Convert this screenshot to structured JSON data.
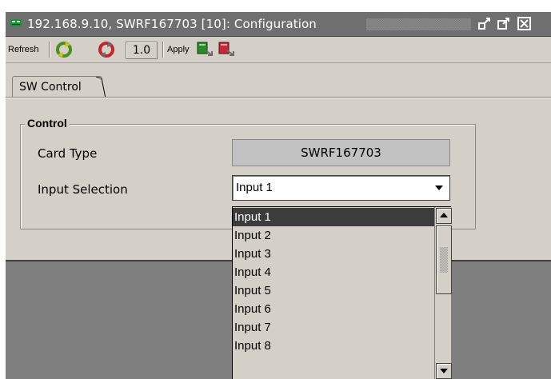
{
  "window": {
    "title": "192.168.9.10, SWRF167703  [10]: Configuration"
  },
  "toolbar": {
    "refresh_label": "Refresh",
    "apply_label": "Apply",
    "zoom_value": "1.0",
    "icons": [
      "refresh-green-icon",
      "refresh-red-icon",
      "apply-green-icon",
      "apply-red-icon"
    ]
  },
  "tabs": [
    {
      "label": "SW Control"
    }
  ],
  "control_group": {
    "title": "Control",
    "card_type": {
      "label": "Card Type",
      "value": "SWRF167703"
    },
    "input_selection": {
      "label": "Input Selection",
      "value": "Input 1",
      "options": [
        "Input 1",
        "Input 2",
        "Input 3",
        "Input 4",
        "Input 5",
        "Input 6",
        "Input 7",
        "Input 8"
      ],
      "highlighted_index": 0
    }
  },
  "colors": {
    "titlebar": "#6f6f6f",
    "panel": "#d4d0c8",
    "selection": "#3c3c3c"
  }
}
